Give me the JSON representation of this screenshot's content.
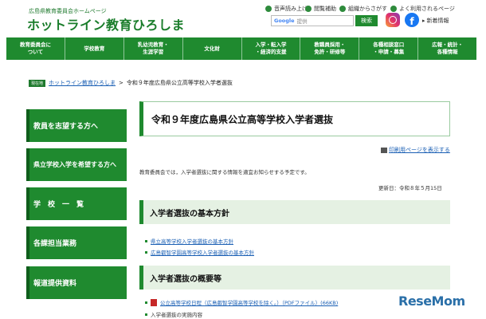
{
  "header": {
    "site_sub": "広島県教育委員会ホームページ",
    "site_title": "ホットライン教育ひろしま",
    "utilities": [
      {
        "label": "音声読み上げ",
        "icon": "speaker-icon"
      },
      {
        "label": "閲覧補助",
        "icon": "accessibility-icon"
      },
      {
        "label": "組織からさがす",
        "icon": "org-icon"
      },
      {
        "label": "よく利用されるページ",
        "icon": "star-icon"
      }
    ],
    "search": {
      "brand": "Google",
      "placeholder": "提供",
      "button": "検索"
    },
    "news_label": "新着情報"
  },
  "nav": {
    "items": [
      "教育委員会に\nついて",
      "学校教育",
      "乳幼児教育・\n生涯学習",
      "文化財",
      "入学・転入学\n・経済的支援",
      "教職員採用・\n免許・研修等",
      "各種相談窓口\n・申請・募集",
      "広報・統計・\n各種情報"
    ]
  },
  "breadcrumb": {
    "home_badge": "現在地",
    "home": "ホットライン教育ひろしま",
    "sep": ">",
    "current": "令和９年度広島県公立高等学校入学者選抜"
  },
  "sidebar": {
    "items": [
      "教員を志望する方へ",
      "県立学校入学を希望する方へ",
      "学　校　一　覧",
      "各課担当業務",
      "報道提供資料"
    ]
  },
  "main": {
    "title": "令和９年度広島県公立高等学校入学者選抜",
    "print_label": "印刷用ページを表示する",
    "intro": "教育委員会では，入学者選抜に関する情報を適宜お知らせする予定です。",
    "updated": "更新日：令和８年５月15日",
    "section1": {
      "title": "入学者選抜の基本方針",
      "links": [
        "県立高等学校入学者選抜の基本方針",
        "広島叡智学園高等学校入学者選抜の基本方針"
      ]
    },
    "section2": {
      "title": "入学者選抜の概要等",
      "links": [
        "公立高等学校日程（広島叡智学園高等学校を除く。）（PDFファイル）(66KB)",
        "入学者選抜の実施内容"
      ]
    }
  },
  "watermark": {
    "text": "ReseMom"
  },
  "colors": {
    "brand_green": "#1f8a2f",
    "dark_green": "#1a7d2b",
    "link_blue": "#1a5fb4",
    "section_bg": "#e5f1e3"
  }
}
